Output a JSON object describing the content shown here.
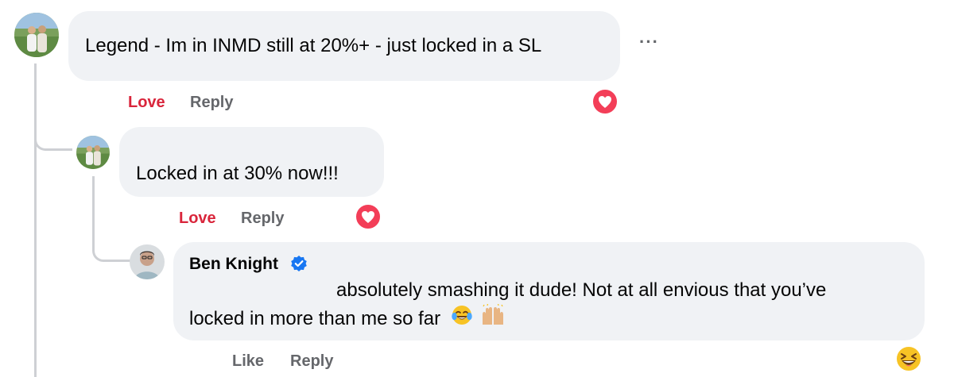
{
  "comments": [
    {
      "text": "Legend - Im in INMD still at 20%+ - just locked in a SL",
      "actions": {
        "reaction_label": "Love",
        "reply_label": "Reply"
      },
      "more_icon": "···",
      "reaction": "love-heart"
    },
    {
      "text": "Locked in at 30% now!!!",
      "actions": {
        "reaction_label": "Love",
        "reply_label": "Reply"
      },
      "reaction": "love-heart"
    },
    {
      "author": "Ben Knight",
      "verified": true,
      "text_line1": "absolutely smashing it dude! Not at all envious that you’ve",
      "text_line2": "locked in more than me so far",
      "emojis": [
        "face-with-tears-of-joy",
        "raising-hands"
      ],
      "actions": {
        "reaction_label": "Like",
        "reply_label": "Reply"
      },
      "reaction": "grinning-squinting-face"
    }
  ],
  "colors": {
    "bubble": "#f0f2f5",
    "love": "#d9253b",
    "muted": "#65676b",
    "verified": "#1877f2",
    "thread_line": "#ced0d4"
  }
}
